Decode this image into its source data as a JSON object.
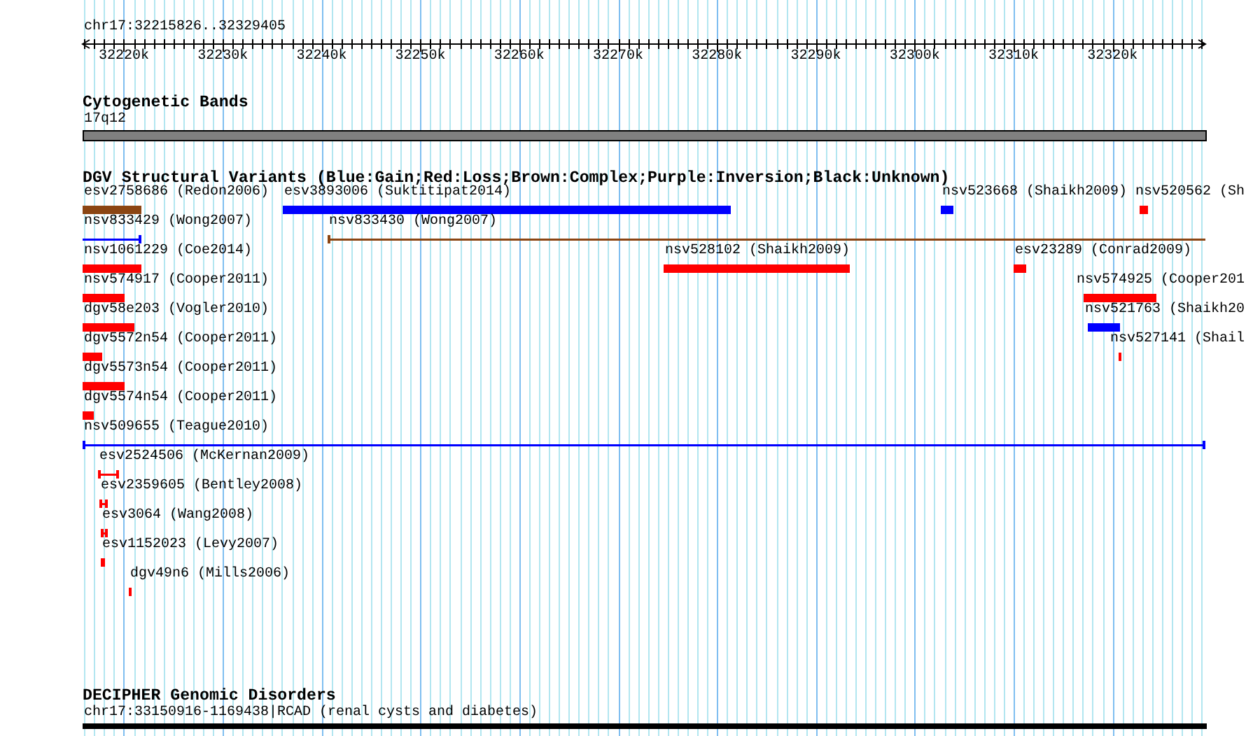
{
  "ruler": {
    "location": "chr17:32215826..32329405",
    "ticks": [
      "32220k",
      "32230k",
      "32240k",
      "32250k",
      "32260k",
      "32270k",
      "32280k",
      "32290k",
      "32300k",
      "32310k",
      "32320k"
    ]
  },
  "tracks": [
    {
      "kind": "bands",
      "title": "Cytogenetic Bands",
      "label": "17q12"
    },
    {
      "kind": "variants",
      "title": "DGV Structural Variants (Blue:Gain;Red:Loss;Brown:Complex;Purple:Inversion;Black:Unknown)",
      "features": [
        {
          "label": "esv2758686 (Redon2006)",
          "kind": "bar",
          "color": "#8b4513"
        },
        {
          "label": "esv3893006 (Suktitipat2014)",
          "kind": "bar",
          "color": "#0000ff"
        },
        {
          "label": "nsv523668 (Shaikh2009)",
          "kind": "bar",
          "color": "#0000ff"
        },
        {
          "label": "nsv520562 (Sh",
          "kind": "bar",
          "color": "#ff0000"
        },
        {
          "label": "nsv833429 (Wong2007)",
          "kind": "line",
          "color": "#0000ff"
        },
        {
          "label": "nsv833430 (Wong2007)",
          "kind": "line",
          "color": "#8b4513"
        },
        {
          "label": "nsv1061229 (Coe2014)",
          "kind": "bar",
          "color": "#ff0000"
        },
        {
          "label": "nsv528102 (Shaikh2009)",
          "kind": "bar",
          "color": "#ff0000"
        },
        {
          "label": "esv23289 (Conrad2009)",
          "kind": "bar",
          "color": "#ff0000"
        },
        {
          "label": "nsv574917 (Cooper2011)",
          "kind": "bar",
          "color": "#ff0000"
        },
        {
          "label": "nsv574925 (Cooper201",
          "kind": "bar",
          "color": "#ff0000"
        },
        {
          "label": "dgv58e203 (Vogler2010)",
          "kind": "bar",
          "color": "#ff0000"
        },
        {
          "label": "nsv521763 (Shaikh20",
          "kind": "bar",
          "color": "#0000ff"
        },
        {
          "label": "dgv5572n54 (Cooper2011)",
          "kind": "bar",
          "color": "#ff0000"
        },
        {
          "label": "nsv527141 (Shail",
          "kind": "bar",
          "color": "#ff0000"
        },
        {
          "label": "dgv5573n54 (Cooper2011)",
          "kind": "bar",
          "color": "#ff0000"
        },
        {
          "label": "dgv5574n54 (Cooper2011)",
          "kind": "bar",
          "color": "#ff0000"
        },
        {
          "label": "nsv509655 (Teague2010)",
          "kind": "line",
          "color": "#0000ff"
        },
        {
          "label": "esv2524506 (McKernan2009)",
          "kind": "line",
          "color": "#ff0000"
        },
        {
          "label": "esv2359605 (Bentley2008)",
          "kind": "line",
          "color": "#ff0000"
        },
        {
          "label": "esv3064 (Wang2008)",
          "kind": "line",
          "color": "#ff0000"
        },
        {
          "label": "esv1152023 (Levy2007)",
          "kind": "bar",
          "color": "#ff0000"
        },
        {
          "label": "dgv49n6 (Mills2006)",
          "kind": "bar",
          "color": "#ff0000"
        }
      ]
    },
    {
      "kind": "disorders",
      "title": "DECIPHER Genomic Disorders",
      "label": "chr17:33150916-1169438|RCAD (renal cysts and diabetes)"
    }
  ]
}
